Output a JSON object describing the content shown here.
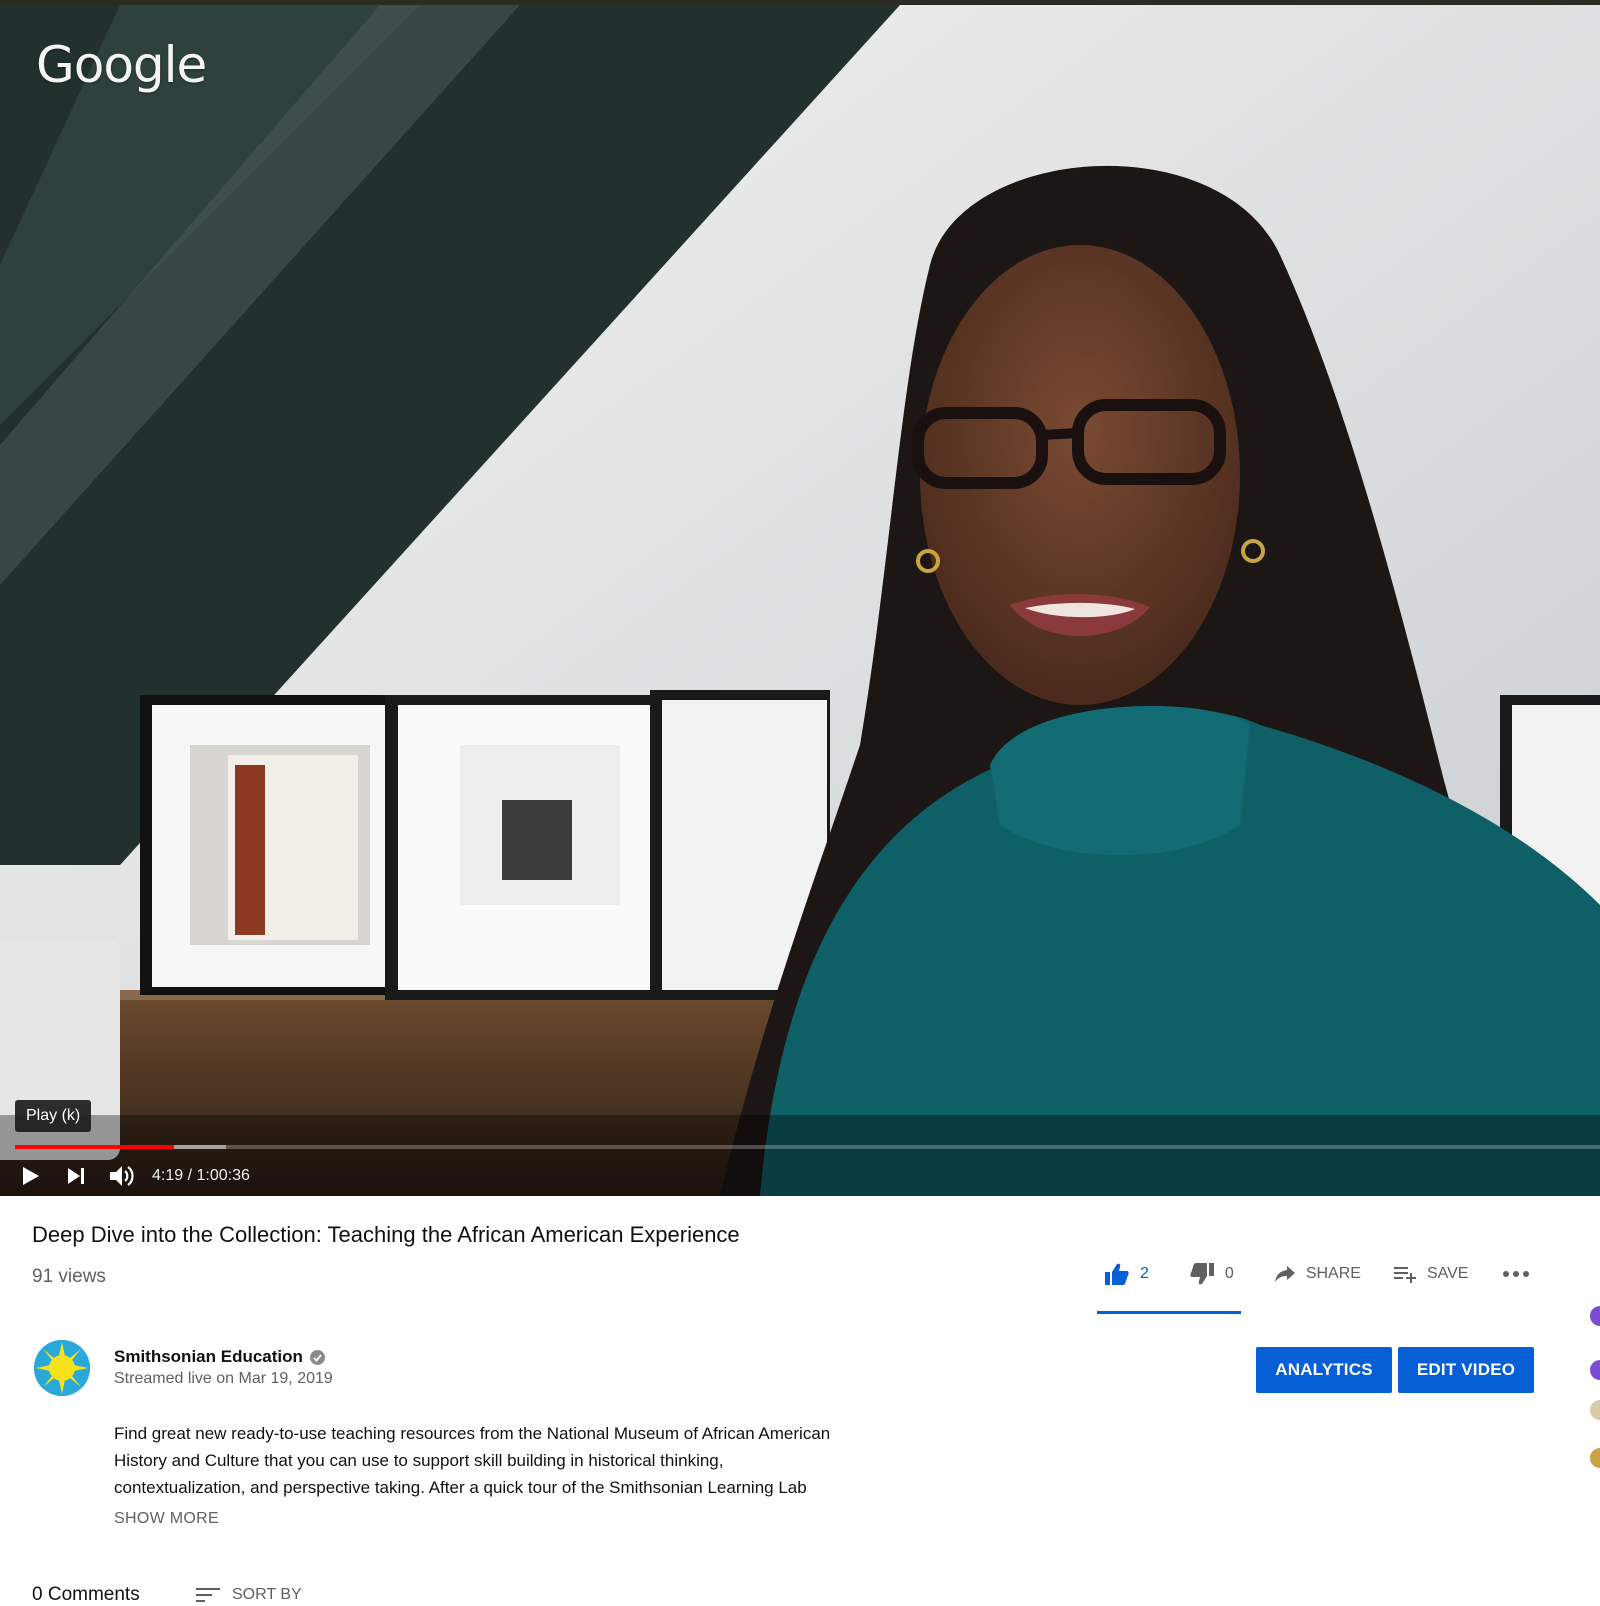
{
  "player": {
    "watermark": "Google",
    "tooltip": "Play (k)",
    "time": "4:19 / 1:00:36",
    "progress_played_fraction": 0.1,
    "progress_loaded_fraction": 0.133,
    "progress_color": "#ff0000",
    "icons": {
      "play": "play-icon",
      "next": "next-icon",
      "volume": "volume-icon"
    }
  },
  "video": {
    "title": "Deep Dive into the Collection: Teaching the African American Experience",
    "views": "91 views"
  },
  "actions": {
    "like_count": "2",
    "dislike_count": "0",
    "share_label": "SHARE",
    "save_label": "SAVE",
    "accent_color": "#065fd4"
  },
  "channel": {
    "name": "Smithsonian Education",
    "date": "Streamed live on Mar 19, 2019"
  },
  "buttons": {
    "analytics": "ANALYTICS",
    "edit": "EDIT VIDEO"
  },
  "description": {
    "line1": "Find great new ready-to-use teaching resources from the National Museum of African American",
    "line2": "History and Culture that you can use to support skill building in historical thinking,",
    "line3": "contextualization, and perspective taking. After a quick tour of the Smithsonian Learning Lab",
    "show_more": "SHOW MORE"
  },
  "comments": {
    "count_label": "0 Comments",
    "sort_label": "SORT BY"
  }
}
